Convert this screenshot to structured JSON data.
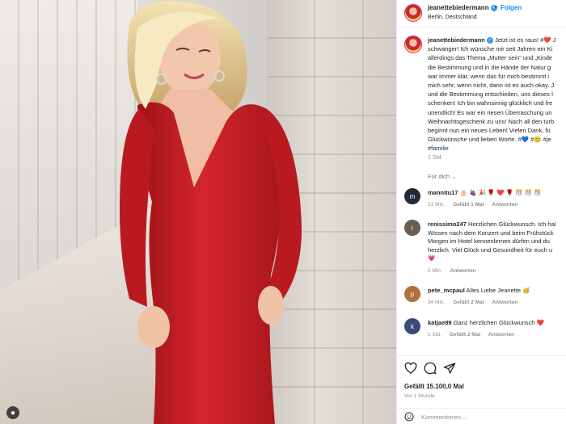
{
  "post": {
    "username": "jeanettebiedermann",
    "verified_symbol": "✓",
    "dot": "•",
    "follow_label": "Folgen",
    "location": "Berlin, Deutschland"
  },
  "caption": {
    "lines": [
      {
        "text": " Jetzt ist es raus! #❤️ J"
      },
      {
        "text": "schwanger! Ich wünsche mir seit Jahren ein Ki"
      },
      {
        "text": "allerdings das Thema „Mutter sein“ und „Kinde"
      },
      {
        "text": "die Bestimmung und in die Hände der Natur g"
      },
      {
        "text": "war immer klar, wenn das für mich bestimmt i"
      },
      {
        "text": "mich sehr, wenn nicht, dann ist es auch okay. J"
      },
      {
        "text": "und die Bestimmung entschieden, uns dieses I"
      },
      {
        "text": "schenken! Ich bin wahnsinnig glücklich und fre"
      },
      {
        "text": "unendlich! Es war ein riesen Überraschung un"
      },
      {
        "text": "Weihnachtsgeschenk zu uns! Nach all den turb"
      },
      {
        "text": "beginnt nun ein neues Leben! Vielen Dank, fü"
      },
      {
        "text": "Glückwünsche und lieben Worte. #💙 #😊 #je"
      }
    ],
    "hashtag_last": "#familie",
    "time": "1 Std."
  },
  "translate_label": "Für dich ⌄",
  "comments": [
    {
      "avatar_initial": "m",
      "username": "mannitu17",
      "lines": [
        " 🎂 🍇 🎉 🌹 ❤️ 🌹 🎊 🎊 🎊"
      ],
      "meta": [
        "21 Min.",
        "Gefällt 1 Mal",
        "Antworten"
      ]
    },
    {
      "avatar_initial": "r",
      "username": "renissimo247",
      "lines": [
        " Herzlichen Glückwunsch. Ich hal",
        "Wissen nach dem Konzert und beim Frühstück",
        "Morgen im Hotel kennenlernen dürfen und du",
        "herzlich. Viel Glück und Gesundheit für euch u",
        "💗"
      ],
      "meta": [
        "5 Min.",
        "Antworten"
      ]
    },
    {
      "avatar_initial": "p",
      "username": "pete_mcpaul",
      "lines": [
        " Alles Liebe Jeanette 🥳"
      ],
      "meta": [
        "34 Min.",
        "Gefällt 2 Mal",
        "Antworten"
      ]
    },
    {
      "avatar_initial": "k",
      "username": "katjae89",
      "lines": [
        " Ganz herzlichen Glückwunsch ❤️"
      ],
      "meta": [
        "1 Std.",
        "Gefällt 2 Mal",
        "Antworten"
      ]
    }
  ],
  "actions": {
    "like_icon": "heart-icon",
    "comment_icon": "comment-icon",
    "share_icon": "share-icon"
  },
  "likes_text": "Gefällt 15.100,0 Mal",
  "posted_time": "Vor 1 Stunde",
  "add_comment": {
    "placeholder": "Kommentieren ..."
  },
  "colors": {
    "link_blue": "#0095f6",
    "dress_red": "#c81e24",
    "muted": "#8e8e8e"
  }
}
